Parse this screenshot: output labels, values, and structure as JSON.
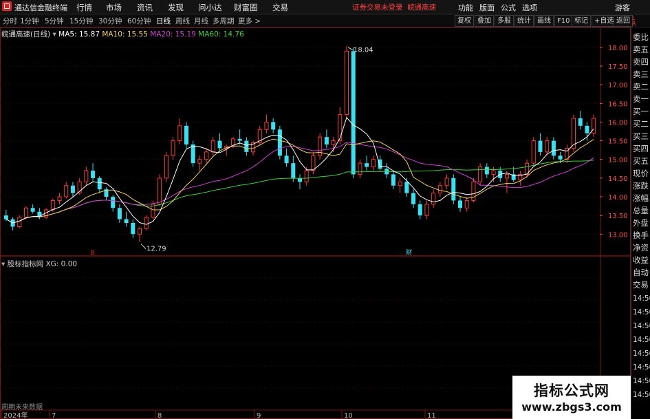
{
  "app": {
    "title": "通达信金融终端",
    "notice": "证券交易未登录",
    "stock_name_tag": "皖通高速"
  },
  "menu": [
    "行情",
    "市场",
    "资讯",
    "发现",
    "问小达",
    "财富圈",
    "交易"
  ],
  "right_menu": [
    "功能",
    "版面",
    "公式",
    "选项",
    "游客"
  ],
  "periods": [
    "分时",
    "1分钟",
    "5分钟",
    "15分钟",
    "30分钟",
    "60分钟",
    "日线",
    "周线",
    "月线",
    "多周期",
    "更多 >"
  ],
  "active_period": "日线",
  "toolbar": [
    "复权",
    "叠加",
    "多股",
    "统计",
    "画线",
    "F10",
    "标记",
    "+自选",
    "返回"
  ],
  "legend": {
    "title": "皖通高速(日线)",
    "ma5": "MA5: 15.87",
    "ma10": "MA10: 15.55",
    "ma20": "MA20: 15.19",
    "ma60": "MA60: 14.76"
  },
  "colors": {
    "up": "#ff3b3b",
    "down": "#3be0f0",
    "ma5": "#ffffff",
    "ma10": "#f0d060",
    "ma20": "#d040d0",
    "ma60": "#40d040",
    "price_axis": "#ff5050",
    "grid": "#7a1515"
  },
  "sub_indicator": {
    "name": "股标指标网",
    "value": "XG: 0.00"
  },
  "price_axis": [
    "18.00",
    "17.50",
    "17.00",
    "16.50",
    "16.00",
    "15.50",
    "15.00",
    "14.50",
    "14.00",
    "13.50",
    "13.00"
  ],
  "annotations": {
    "high": "18.04",
    "low": "12.79",
    "marker_left": "B",
    "marker_mid": "财"
  },
  "right_panel": [
    "委比",
    "卖五",
    "卖四",
    "卖三",
    "卖二",
    "卖一",
    "买一",
    "买二",
    "买三",
    "买四",
    "买五",
    "现价",
    "涨跌",
    "涨幅",
    "总量",
    "外盘",
    "换手",
    "净资",
    "收益",
    "自动",
    "交易"
  ],
  "right_times": [
    "14:50",
    "14:50",
    "14:50",
    "14:50",
    "14:50",
    "14:50",
    "14:50",
    "14:50"
  ],
  "x_axis": [
    "2024年",
    "7",
    "8",
    "9",
    "10",
    "11"
  ],
  "footer": "周期未来数据",
  "watermark": {
    "line1": "指标公式网",
    "line2": "www.zbgs3.com"
  },
  "chart_data": {
    "type": "candlestick",
    "ylim": [
      12.6,
      18.2
    ],
    "candles": [
      [
        13.5,
        13.65,
        13.35,
        13.4
      ],
      [
        13.4,
        13.45,
        13.1,
        13.2
      ],
      [
        13.2,
        13.5,
        13.15,
        13.45
      ],
      [
        13.45,
        13.75,
        13.4,
        13.7
      ],
      [
        13.7,
        13.8,
        13.55,
        13.6
      ],
      [
        13.6,
        13.7,
        13.4,
        13.45
      ],
      [
        13.45,
        13.7,
        13.4,
        13.65
      ],
      [
        13.65,
        13.95,
        13.6,
        13.9
      ],
      [
        13.9,
        14.1,
        13.8,
        14.0
      ],
      [
        14.0,
        14.4,
        13.95,
        14.3
      ],
      [
        14.3,
        14.4,
        14.0,
        14.1
      ],
      [
        14.1,
        14.5,
        14.05,
        14.4
      ],
      [
        14.4,
        14.8,
        14.3,
        14.7
      ],
      [
        14.7,
        14.9,
        14.4,
        14.5
      ],
      [
        14.5,
        14.55,
        14.1,
        14.2
      ],
      [
        14.2,
        14.25,
        13.9,
        14.0
      ],
      [
        14.0,
        14.05,
        13.6,
        13.7
      ],
      [
        13.7,
        13.8,
        13.3,
        13.4
      ],
      [
        13.4,
        13.6,
        13.2,
        13.3
      ],
      [
        13.3,
        13.4,
        12.9,
        13.0
      ],
      [
        13.0,
        13.2,
        12.79,
        13.15
      ],
      [
        13.15,
        13.5,
        13.1,
        13.45
      ],
      [
        13.45,
        13.9,
        13.4,
        13.8
      ],
      [
        13.8,
        14.6,
        13.75,
        14.5
      ],
      [
        14.5,
        15.2,
        14.4,
        15.1
      ],
      [
        15.1,
        15.6,
        15.0,
        15.5
      ],
      [
        15.5,
        16.1,
        15.4,
        15.9
      ],
      [
        15.9,
        16.0,
        15.3,
        15.4
      ],
      [
        15.4,
        15.5,
        14.8,
        14.9
      ],
      [
        14.9,
        15.1,
        14.7,
        15.0
      ],
      [
        15.0,
        15.3,
        14.9,
        15.2
      ],
      [
        15.2,
        15.6,
        15.1,
        15.5
      ],
      [
        15.5,
        15.7,
        15.2,
        15.3
      ],
      [
        15.3,
        15.4,
        15.1,
        15.35
      ],
      [
        15.35,
        15.6,
        15.3,
        15.55
      ],
      [
        15.55,
        15.8,
        15.4,
        15.5
      ],
      [
        15.5,
        15.6,
        15.1,
        15.2
      ],
      [
        15.2,
        15.5,
        15.1,
        15.45
      ],
      [
        15.45,
        15.9,
        15.4,
        15.8
      ],
      [
        15.8,
        16.2,
        15.7,
        16.0
      ],
      [
        16.0,
        16.1,
        15.7,
        15.8
      ],
      [
        15.8,
        15.9,
        15.0,
        15.1
      ],
      [
        15.1,
        15.3,
        14.8,
        14.9
      ],
      [
        14.9,
        15.1,
        14.4,
        14.5
      ],
      [
        14.5,
        14.6,
        14.2,
        14.4
      ],
      [
        14.4,
        14.8,
        14.3,
        14.7
      ],
      [
        14.7,
        15.2,
        14.6,
        15.1
      ],
      [
        15.1,
        15.7,
        15.0,
        15.6
      ],
      [
        15.6,
        15.8,
        15.3,
        15.4
      ],
      [
        15.4,
        15.6,
        15.2,
        15.5
      ],
      [
        15.5,
        16.4,
        15.4,
        16.2
      ],
      [
        16.2,
        18.04,
        16.1,
        17.9
      ],
      [
        17.9,
        18.0,
        14.5,
        14.6
      ],
      [
        14.6,
        15.0,
        14.5,
        14.9
      ],
      [
        14.9,
        15.1,
        14.7,
        14.8
      ],
      [
        14.8,
        15.1,
        14.7,
        15.0
      ],
      [
        15.0,
        15.1,
        14.7,
        14.75
      ],
      [
        14.75,
        14.9,
        14.5,
        14.6
      ],
      [
        14.6,
        14.7,
        14.2,
        14.3
      ],
      [
        14.3,
        14.5,
        14.1,
        14.4
      ],
      [
        14.4,
        14.5,
        14.0,
        14.1
      ],
      [
        14.1,
        14.2,
        13.7,
        13.8
      ],
      [
        13.8,
        13.9,
        13.4,
        13.5
      ],
      [
        13.5,
        13.9,
        13.4,
        13.8
      ],
      [
        13.8,
        14.2,
        13.7,
        14.1
      ],
      [
        14.1,
        14.4,
        14.0,
        14.3
      ],
      [
        14.3,
        14.6,
        14.2,
        14.5
      ],
      [
        14.5,
        14.6,
        13.8,
        13.9
      ],
      [
        13.9,
        14.0,
        13.6,
        13.7
      ],
      [
        13.7,
        14.0,
        13.6,
        13.9
      ],
      [
        13.9,
        14.5,
        13.85,
        14.4
      ],
      [
        14.4,
        14.9,
        14.3,
        14.8
      ],
      [
        14.8,
        14.9,
        14.5,
        14.6
      ],
      [
        14.6,
        14.8,
        14.4,
        14.7
      ],
      [
        14.7,
        14.8,
        14.4,
        14.5
      ],
      [
        14.5,
        14.7,
        14.1,
        14.6
      ],
      [
        14.6,
        14.8,
        14.4,
        14.45
      ],
      [
        14.45,
        14.7,
        14.3,
        14.6
      ],
      [
        14.6,
        15.0,
        14.5,
        14.9
      ],
      [
        14.9,
        15.6,
        14.85,
        15.5
      ],
      [
        15.5,
        15.7,
        15.1,
        15.2
      ],
      [
        15.2,
        15.6,
        15.1,
        15.5
      ],
      [
        15.5,
        15.6,
        15.0,
        15.1
      ],
      [
        15.1,
        15.2,
        14.9,
        15.0
      ],
      [
        15.0,
        15.4,
        14.9,
        15.3
      ],
      [
        15.3,
        16.2,
        15.2,
        16.1
      ],
      [
        16.1,
        16.3,
        15.8,
        15.9
      ],
      [
        15.9,
        16.0,
        15.5,
        15.7
      ],
      [
        15.7,
        16.2,
        15.6,
        16.1
      ]
    ]
  }
}
